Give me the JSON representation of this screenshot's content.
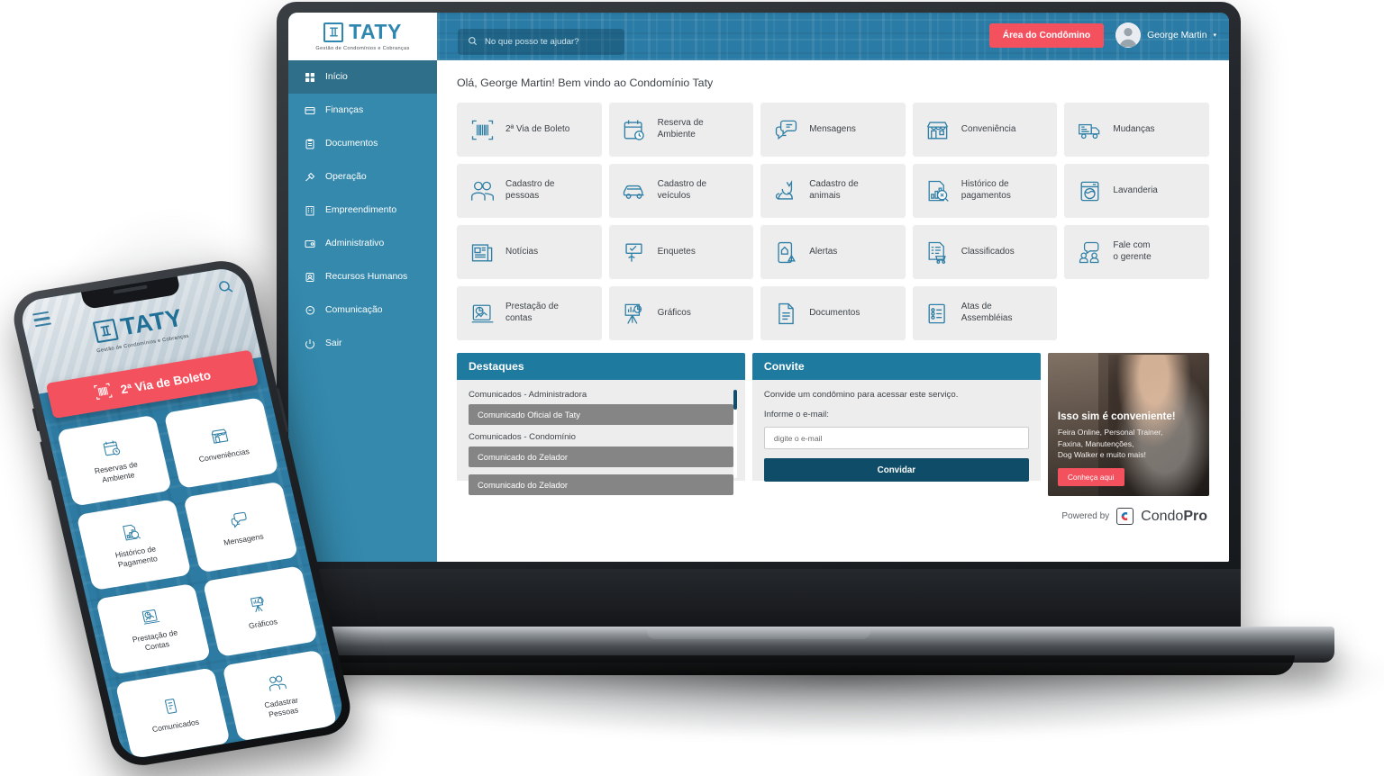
{
  "brand": {
    "name": "TATY",
    "tagline": "Gestão de Condomínios e Cobranças",
    "accent_blue": "#2f87b0",
    "header_blue": "#2d7ba3",
    "sidebar_blue": "#3489ad",
    "panel_header_blue": "#1f7aa0",
    "accent_red": "#f4515f",
    "button_dark": "#0f4c68"
  },
  "header": {
    "search_placeholder": "No que posso te ajudar?",
    "search_icon": "search-icon",
    "condo_area_button": "Área do Condômino",
    "user_name": "George Martin",
    "user_caret": "▾",
    "avatar_icon": "user-avatar-icon"
  },
  "sidebar": {
    "items": [
      {
        "label": "Início",
        "icon": "grid-dashboard-icon",
        "active": true
      },
      {
        "label": "Finanças",
        "icon": "finance-card-icon",
        "active": false
      },
      {
        "label": "Documentos",
        "icon": "clipboard-document-icon",
        "active": false
      },
      {
        "label": "Operação",
        "icon": "tools-operation-icon",
        "active": false
      },
      {
        "label": "Empreendimento",
        "icon": "building-icon",
        "active": false
      },
      {
        "label": "Administrativo",
        "icon": "admin-card-icon",
        "active": false
      },
      {
        "label": "Recursos Humanos",
        "icon": "person-badge-icon",
        "active": false
      },
      {
        "label": "Comunicação",
        "icon": "chat-bubble-icon",
        "active": false
      },
      {
        "label": "Sair",
        "icon": "power-logout-icon",
        "active": false
      }
    ]
  },
  "main": {
    "greeting": "Olá, George Martin! Bem vindo ao Condomínio Taty",
    "tiles": [
      {
        "label": "2ª Via de Boleto",
        "icon": "barcode-icon"
      },
      {
        "label": "Reserva de\nAmbiente",
        "icon": "calendar-clock-icon"
      },
      {
        "label": "Mensagens",
        "icon": "chat-bubbles-icon"
      },
      {
        "label": "Conveniência",
        "icon": "storefront-icon"
      },
      {
        "label": "Mudanças",
        "icon": "moving-truck-icon"
      },
      {
        "label": "Cadastro de\npessoas",
        "icon": "two-people-icon"
      },
      {
        "label": "Cadastro de\nveículos",
        "icon": "car-icon"
      },
      {
        "label": "Cadastro de\nanimais",
        "icon": "cat-pet-icon"
      },
      {
        "label": "Histórico de\npagamentos",
        "icon": "payment-history-icon"
      },
      {
        "label": "Lavanderia",
        "icon": "washing-machine-icon"
      },
      {
        "label": "Notícias",
        "icon": "newspaper-icon"
      },
      {
        "label": "Enquetes",
        "icon": "poll-signboard-icon"
      },
      {
        "label": "Alertas",
        "icon": "alert-phone-icon"
      },
      {
        "label": "Classificados",
        "icon": "classifieds-cart-icon"
      },
      {
        "label": "Fale com\no gerente",
        "icon": "contact-manager-icon"
      },
      {
        "label": "Prestação de\ncontas",
        "icon": "accounting-report-icon"
      },
      {
        "label": "Gráficos",
        "icon": "charts-easel-icon"
      },
      {
        "label": "Documentos",
        "icon": "document-file-icon"
      },
      {
        "label": "Atas de\nAssembléias",
        "icon": "meeting-minutes-icon"
      }
    ]
  },
  "highlights": {
    "title": "Destaques",
    "groups": [
      {
        "label": "Comunicados - Administradora",
        "items": [
          "Comunicado Oficial de Taty"
        ]
      },
      {
        "label": "Comunicados - Condomínio",
        "items": [
          "Comunicado do Zelador",
          "Comunicado do Zelador"
        ]
      }
    ]
  },
  "invite": {
    "title": "Convite",
    "description": "Convide um condômino para acessar este serviço.",
    "field_label": "Informe o e-mail:",
    "email_placeholder": "digite o e-mail",
    "email_value": "",
    "submit_label": "Convidar"
  },
  "ad": {
    "title": "Isso sim é conveniente!",
    "lines": [
      "Feira Online, Personal Trainer,",
      "Faxina, Manutenções,",
      "Dog Walker e muito mais!"
    ],
    "button_label": "Conheça aqui"
  },
  "footer": {
    "powered_by": "Powered by",
    "product_light": "Condo",
    "product_bold": "Pro",
    "logo_icon": "condopro-logo-icon"
  },
  "phone": {
    "menu_icon": "hamburger-menu-icon",
    "search_icon": "search-icon",
    "brand_name": "TATY",
    "brand_tagline": "Gestão de Condomínios e Cobranças",
    "boleto_button": "2ª Via de Boleto",
    "boleto_icon": "barcode-icon",
    "tiles": [
      {
        "label": "Reservas de\nAmbiente",
        "icon": "calendar-clock-icon"
      },
      {
        "label": "Conveniências",
        "icon": "storefront-icon"
      },
      {
        "label": "Histórico de\nPagamento",
        "icon": "payment-history-icon"
      },
      {
        "label": "Mensagens",
        "icon": "chat-bubbles-icon"
      },
      {
        "label": "Prestação de\nContas",
        "icon": "accounting-report-icon"
      },
      {
        "label": "Gráficos",
        "icon": "charts-easel-icon"
      },
      {
        "label": "Comunicados",
        "icon": "announcement-icon"
      },
      {
        "label": "Cadastrar\nPessoas",
        "icon": "two-people-icon"
      }
    ]
  }
}
